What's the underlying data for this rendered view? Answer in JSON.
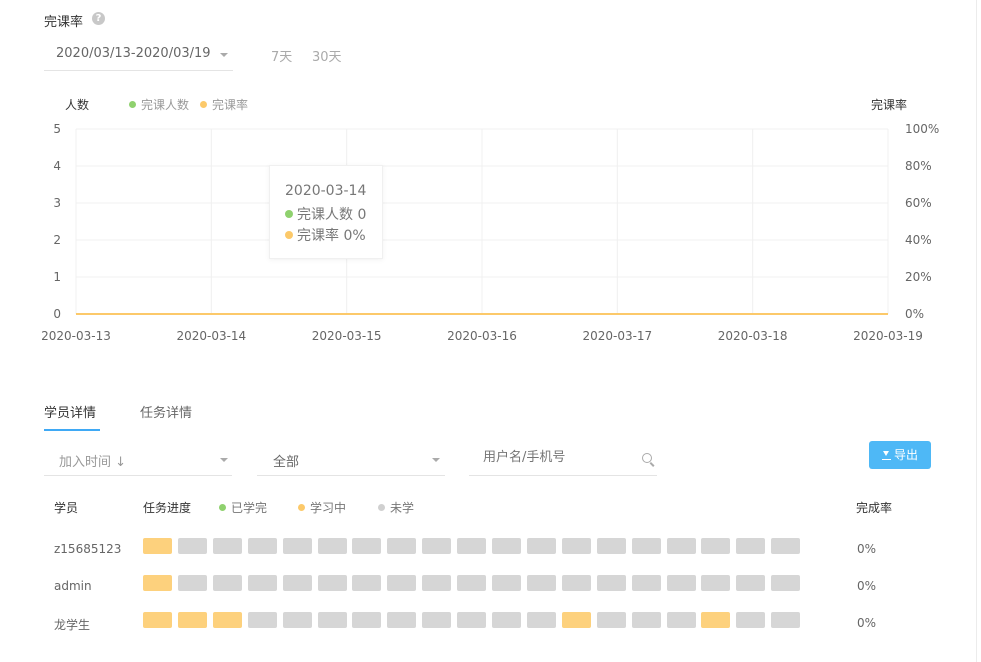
{
  "header": {
    "title": "完课率",
    "help": "?"
  },
  "date_range": {
    "value": "2020/03/13-2020/03/19"
  },
  "quick_ranges": [
    "7天",
    "30天"
  ],
  "chart_data": {
    "type": "line",
    "title": "",
    "x": [
      "2020-03-13",
      "2020-03-14",
      "2020-03-15",
      "2020-03-16",
      "2020-03-17",
      "2020-03-18",
      "2020-03-19"
    ],
    "left_axis_label": "人数",
    "right_axis_label": "完课率",
    "left_ticks": [
      "0",
      "1",
      "2",
      "3",
      "4",
      "5"
    ],
    "right_ticks": [
      "0%",
      "20%",
      "40%",
      "60%",
      "80%",
      "100%"
    ],
    "ylim_left": [
      0,
      5
    ],
    "ylim_right": [
      0,
      100
    ],
    "grid": true,
    "legend_position": "top-left",
    "series": [
      {
        "name": "完课人数",
        "axis": "left",
        "color": "#8fd16e",
        "values": [
          0,
          0,
          0,
          0,
          0,
          0,
          0
        ]
      },
      {
        "name": "完课率",
        "axis": "right",
        "color": "#fcc96a",
        "values": [
          0,
          0,
          0,
          0,
          0,
          0,
          0
        ]
      }
    ],
    "tooltip": {
      "date": "2020-03-14",
      "count_label": "完课人数",
      "count_value": "0",
      "rate_label": "完课率",
      "rate_value": "0%"
    }
  },
  "tabs": [
    {
      "label": "学员详情",
      "active": true
    },
    {
      "label": "任务详情",
      "active": false
    }
  ],
  "filters": {
    "sort": "加入时间 ↓",
    "status": "全部",
    "search_placeholder": "用户名/手机号"
  },
  "export_label": "导出",
  "export_icon": "download-icon",
  "table": {
    "col_student": "学员",
    "col_progress": "任务进度",
    "col_rate": "完成率",
    "status_legend": [
      {
        "label": "已学完",
        "color": "#8fd16e"
      },
      {
        "label": "学习中",
        "color": "#fcc96a"
      },
      {
        "label": "未学",
        "color": "#d0d0d0"
      }
    ],
    "colors": {
      "done": "#8fd16e",
      "learning": "#fdd17d",
      "not_started": "#d6d6d6"
    },
    "rows": [
      {
        "name": "z15685123",
        "rate": "0%",
        "progress": [
          "learning",
          "not_started",
          "not_started",
          "not_started",
          "not_started",
          "not_started",
          "not_started",
          "not_started",
          "not_started",
          "not_started",
          "not_started",
          "not_started",
          "not_started",
          "not_started",
          "not_started",
          "not_started",
          "not_started",
          "not_started",
          "not_started"
        ]
      },
      {
        "name": "admin",
        "rate": "0%",
        "progress": [
          "learning",
          "not_started",
          "not_started",
          "not_started",
          "not_started",
          "not_started",
          "not_started",
          "not_started",
          "not_started",
          "not_started",
          "not_started",
          "not_started",
          "not_started",
          "not_started",
          "not_started",
          "not_started",
          "not_started",
          "not_started",
          "not_started"
        ]
      },
      {
        "name": "龙学生",
        "rate": "0%",
        "progress": [
          "learning",
          "learning",
          "learning",
          "not_started",
          "not_started",
          "not_started",
          "not_started",
          "not_started",
          "not_started",
          "not_started",
          "not_started",
          "not_started",
          "learning",
          "not_started",
          "not_started",
          "not_started",
          "learning",
          "not_started",
          "not_started"
        ]
      }
    ]
  }
}
